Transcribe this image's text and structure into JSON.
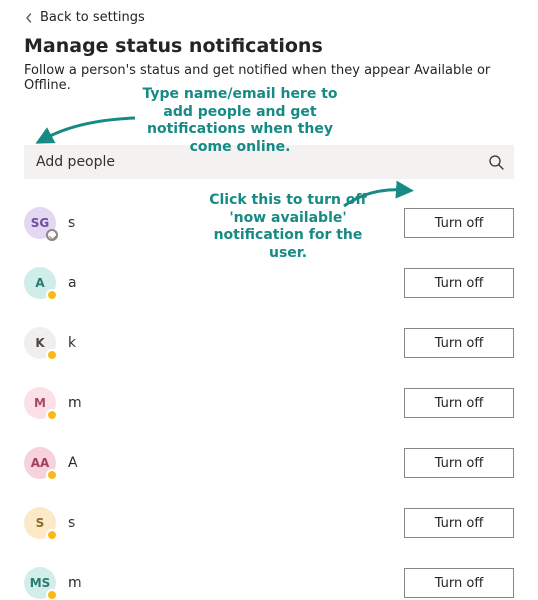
{
  "back_label": "Back to settings",
  "title": "Manage status notifications",
  "subtitle": "Follow a person's status and get notified when they appear Available or Offline.",
  "search": {
    "placeholder": "Add people"
  },
  "turn_off_label": "Turn off",
  "annotations": {
    "add_people": "Type name/email here to add people and get notifications when they come online.",
    "turn_off": "Click this to turn off 'now available' notification for the user."
  },
  "people": [
    {
      "initials": "SG",
      "letter": "s",
      "avatar_bg": "#e3d7f2",
      "avatar_fg": "#6b4f9e",
      "presence": "offline",
      "redact_w": 90
    },
    {
      "initials": "A",
      "letter": "a",
      "avatar_bg": "#cfeeea",
      "avatar_fg": "#2a7a72",
      "presence": "away",
      "redact_w": 96
    },
    {
      "initials": "K",
      "letter": "k",
      "avatar_bg": "#f0efee",
      "avatar_fg": "#4a4846",
      "presence": "away",
      "redact_w": 128
    },
    {
      "initials": "M",
      "letter": "m",
      "avatar_bg": "#fbe0e6",
      "avatar_fg": "#a4496b",
      "presence": "away",
      "redact_w": 150
    },
    {
      "initials": "AA",
      "letter": "A",
      "avatar_bg": "#f6d2da",
      "avatar_fg": "#a23f5d",
      "presence": "away",
      "redact_w": 118
    },
    {
      "initials": "S",
      "letter": "s",
      "avatar_bg": "#fde9c8",
      "avatar_fg": "#8a6b2a",
      "presence": "away",
      "redact_w": 78
    },
    {
      "initials": "MS",
      "letter": "m",
      "avatar_bg": "#d3eeea",
      "avatar_fg": "#2a7a72",
      "presence": "away",
      "redact_w": 110
    }
  ]
}
